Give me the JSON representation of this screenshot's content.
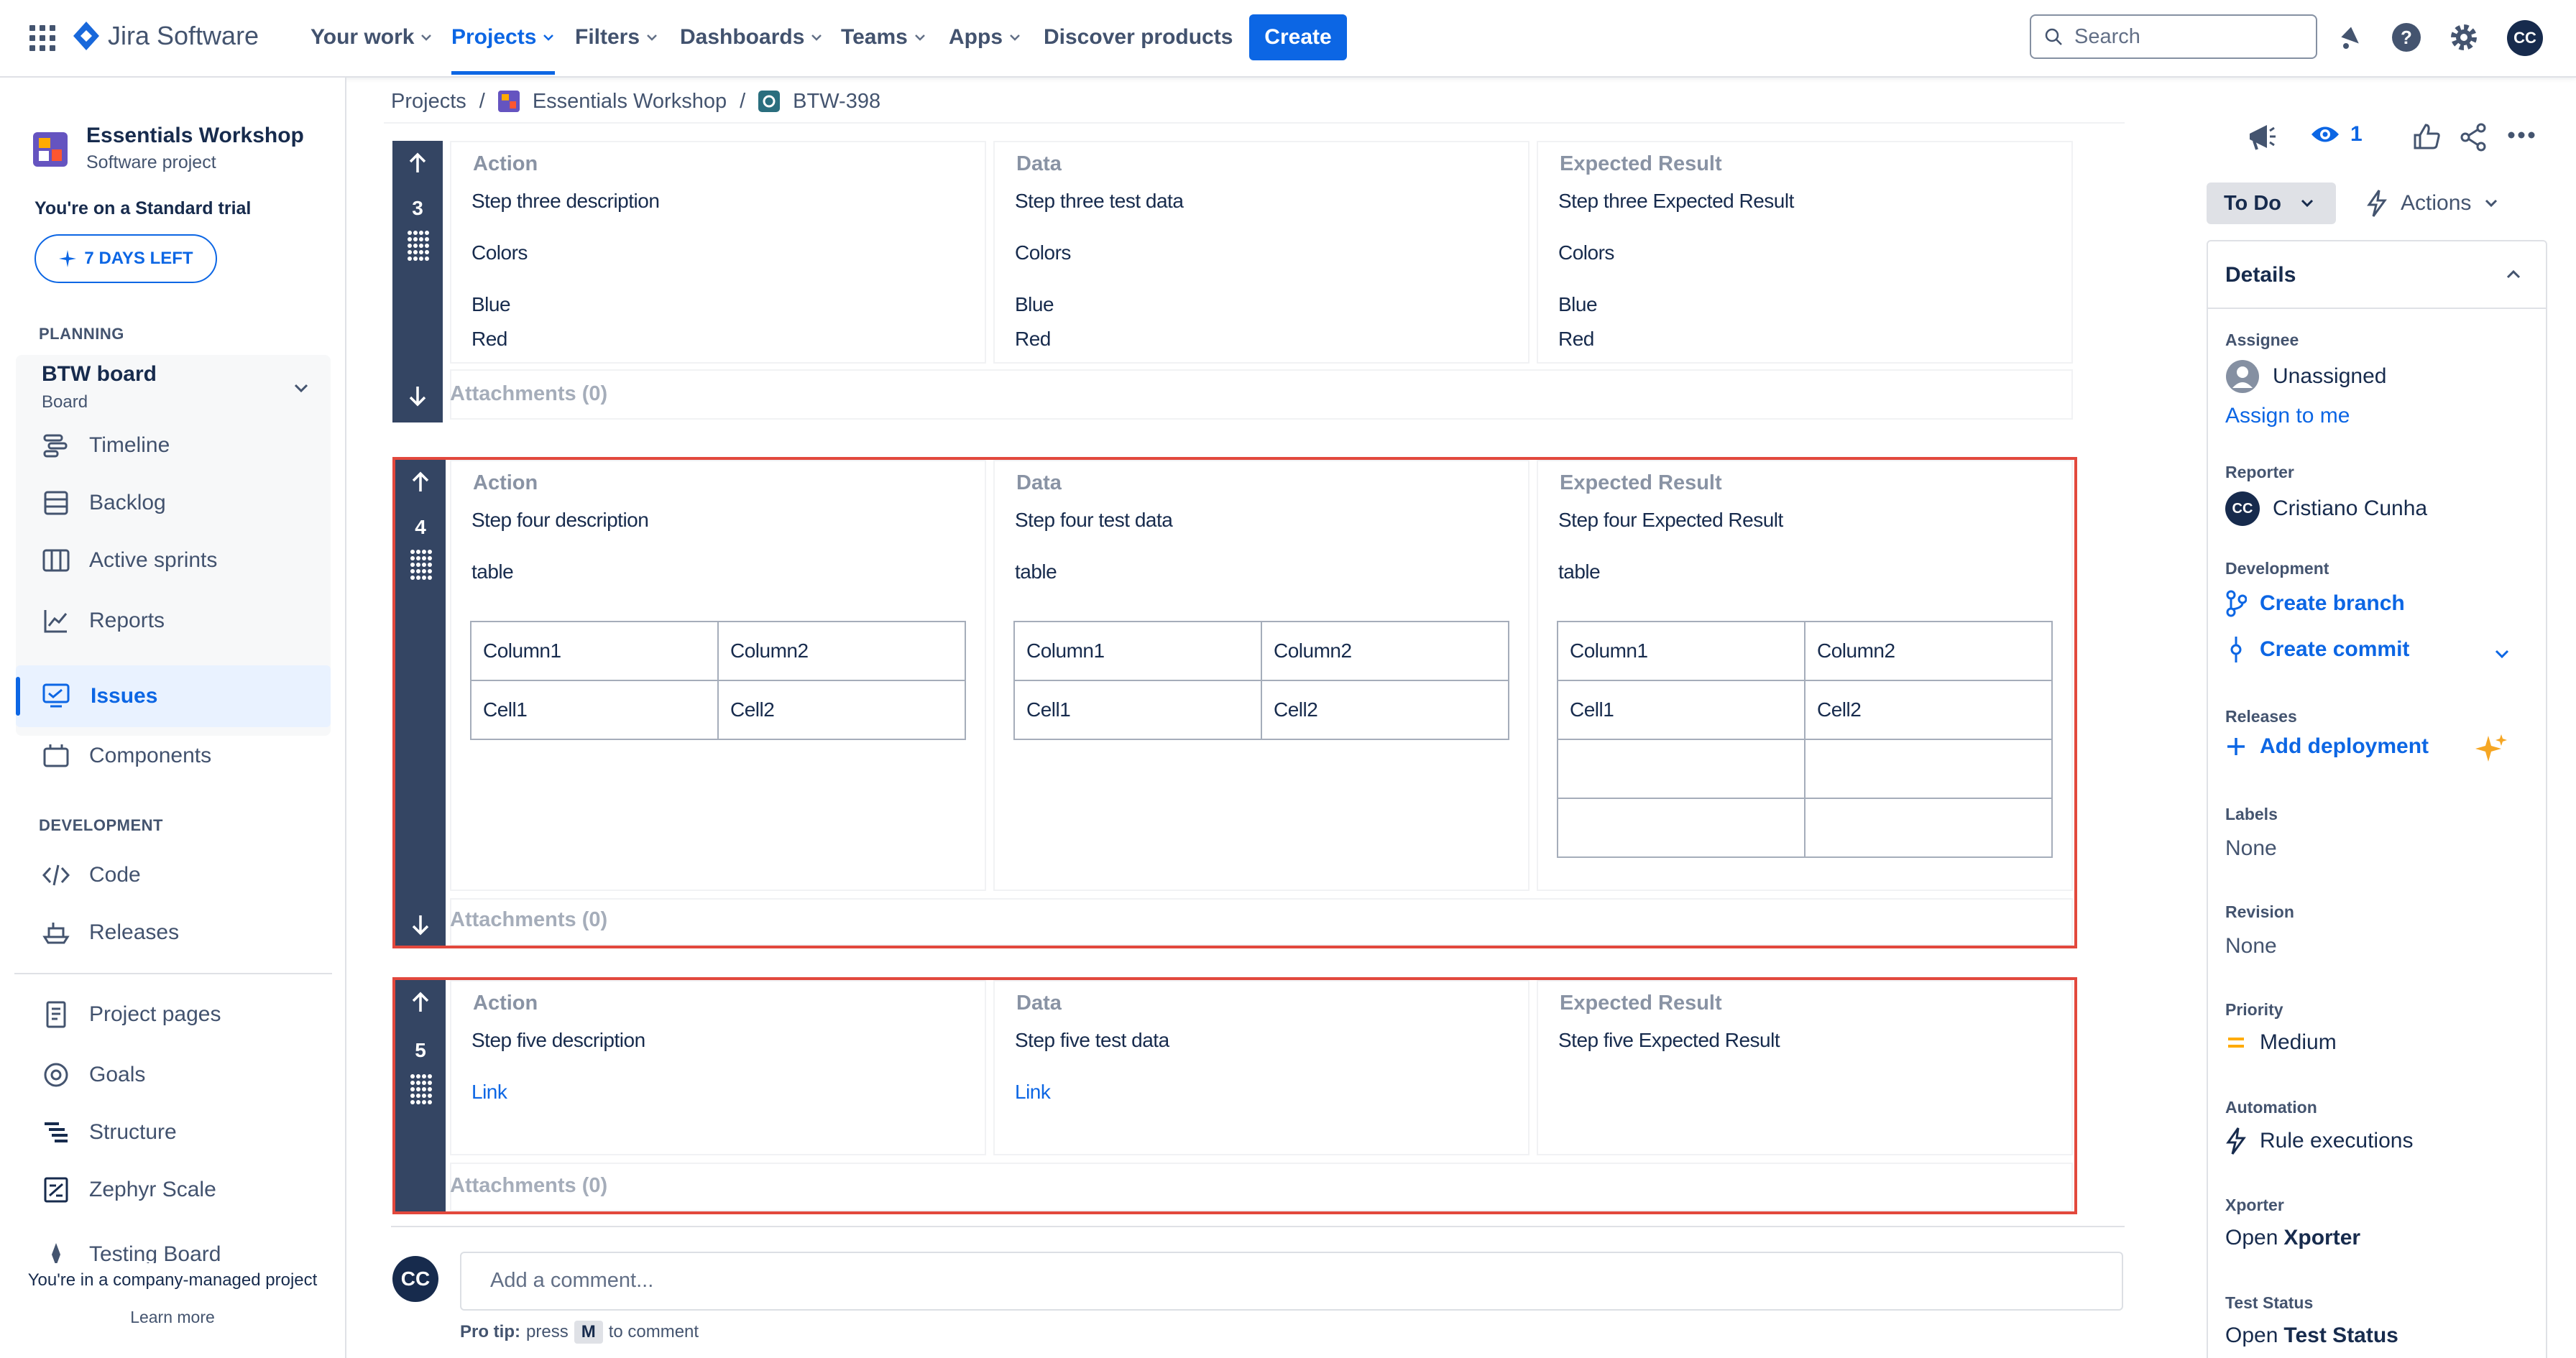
{
  "topnav": {
    "app_name": "Jira Software",
    "items": [
      {
        "label": "Your work"
      },
      {
        "label": "Projects"
      },
      {
        "label": "Filters"
      },
      {
        "label": "Dashboards"
      },
      {
        "label": "Teams"
      },
      {
        "label": "Apps"
      },
      {
        "label": "Discover products"
      }
    ],
    "create_label": "Create",
    "search_placeholder": "Search",
    "avatar_initials": "CC"
  },
  "sidebar": {
    "project_name": "Essentials Workshop",
    "project_type": "Software project",
    "trial_text": "You're on a Standard trial",
    "trial_badge": "7 DAYS LEFT",
    "planning_header": "PLANNING",
    "board_name": "BTW board",
    "board_sub": "Board",
    "planning_items": [
      "Timeline",
      "Backlog",
      "Active sprints",
      "Reports"
    ],
    "issues_label": "Issues",
    "components_label": "Components",
    "development_header": "DEVELOPMENT",
    "dev_items": [
      "Code",
      "Releases"
    ],
    "other_items": [
      "Project pages",
      "Goals",
      "Structure",
      "Zephyr Scale",
      "Testing Board"
    ],
    "footer_text": "You're in a company-managed project",
    "footer_link": "Learn more"
  },
  "breadcrumb": {
    "projects": "Projects",
    "project": "Essentials Workshop",
    "issue": "BTW-398",
    "sep": "/"
  },
  "steps": {
    "headers": {
      "action": "Action",
      "data": "Data",
      "expected": "Expected Result"
    },
    "attachments": "Attachments (0)",
    "s3": {
      "num": "3",
      "action": [
        "Step three description",
        "Colors",
        "Blue",
        "Red"
      ],
      "data": [
        "Step three test data",
        "Colors",
        "Blue",
        "Red"
      ],
      "expected": [
        "Step three Expected Result",
        "Colors",
        "Blue",
        "Red"
      ]
    },
    "s4": {
      "num": "4",
      "action": [
        "Step four description",
        "table"
      ],
      "data": [
        "Step four test data",
        "table"
      ],
      "expected": [
        "Step four Expected Result",
        "table"
      ],
      "table": {
        "c1": "Column1",
        "c2": "Column2",
        "r1": "Cell1",
        "r2": "Cell2"
      }
    },
    "s5": {
      "num": "5",
      "action": [
        "Step five description",
        "Link"
      ],
      "data": [
        "Step five test data",
        "Link"
      ],
      "expected": [
        "Step five Expected Result"
      ]
    }
  },
  "comment": {
    "avatar": "CC",
    "placeholder": "Add a comment...",
    "pro_tip": "Pro tip:",
    "press": "press",
    "key": "M",
    "to_comment": "to comment"
  },
  "rightpanel": {
    "watch_count": "1",
    "status": "To Do",
    "actions": "Actions",
    "details": "Details",
    "assignee_label": "Assignee",
    "assignee": "Unassigned",
    "assign_to_me": "Assign to me",
    "reporter_label": "Reporter",
    "reporter": "Cristiano Cunha",
    "reporter_initials": "CC",
    "development_label": "Development",
    "create_branch": "Create branch",
    "create_commit": "Create commit",
    "releases_label": "Releases",
    "add_deployment": "Add deployment",
    "labels_label": "Labels",
    "labels": "None",
    "revision_label": "Revision",
    "revision": "None",
    "priority_label": "Priority",
    "priority": "Medium",
    "automation_label": "Automation",
    "automation": "Rule executions",
    "xporter_label": "Xporter",
    "xporter_open": "Open",
    "xporter_name": "Xporter",
    "teststatus_label": "Test Status",
    "teststatus_open": "Open",
    "teststatus_name": "Test Status"
  },
  "colors": {
    "brand": "#0c66e4",
    "step_bar": "#344563",
    "highlight": "#e2483d",
    "priority": "#ffab00"
  }
}
